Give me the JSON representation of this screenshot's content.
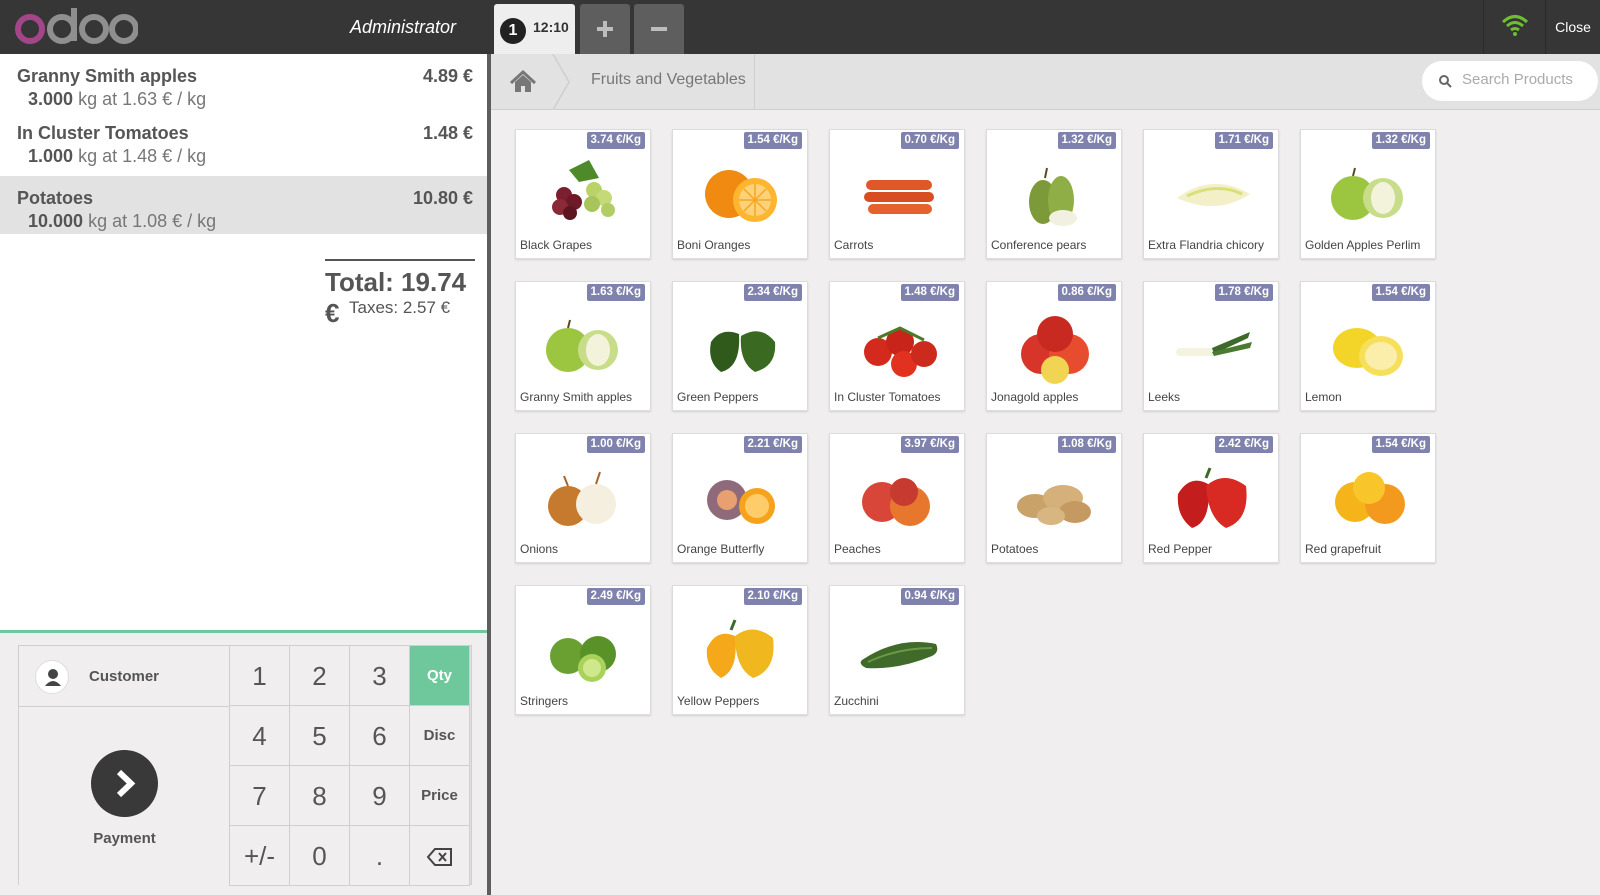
{
  "header": {
    "logo_text": "odoo",
    "user": "Administrator",
    "order": {
      "number": "1",
      "time": "12:10"
    },
    "close_label": "Close"
  },
  "order_lines": [
    {
      "name": "Granny Smith apples",
      "price": "4.89 €",
      "qty": "3.000",
      "detail": "kg at 1.63 € / kg",
      "selected": false
    },
    {
      "name": "In Cluster Tomatoes",
      "price": "1.48 €",
      "qty": "1.000",
      "detail": "kg at 1.48 € / kg",
      "selected": false
    },
    {
      "name": "Potatoes",
      "price": "10.80 €",
      "qty": "10.000",
      "detail": "kg at 1.08 € / kg",
      "selected": true
    }
  ],
  "summary": {
    "total": "Total: 19.74 €",
    "taxes": "Taxes: 2.57 €"
  },
  "pad": {
    "customer_label": "Customer",
    "payment_label": "Payment",
    "keys": [
      "1",
      "2",
      "3",
      "Qty",
      "4",
      "5",
      "6",
      "Disc",
      "7",
      "8",
      "9",
      "Price",
      "+/-",
      "0",
      ".",
      "⌫"
    ],
    "active_mode": "Qty"
  },
  "breadcrumb": {
    "category": "Fruits and Vegetables"
  },
  "search": {
    "placeholder": "Search Products"
  },
  "colors": {
    "accent": "#6ec89b",
    "price_tag": "#7f82ac",
    "topbar": "#363636"
  },
  "products": [
    {
      "name": "Black Grapes",
      "price": "3.74 €/Kg",
      "icon": "grapes"
    },
    {
      "name": "Boni Oranges",
      "price": "1.54 €/Kg",
      "icon": "orange"
    },
    {
      "name": "Carrots",
      "price": "0.70 €/Kg",
      "icon": "carrot"
    },
    {
      "name": "Conference pears",
      "price": "1.32 €/Kg",
      "icon": "pear"
    },
    {
      "name": "Extra Flandria chicory",
      "price": "1.71 €/Kg",
      "icon": "chicory"
    },
    {
      "name": "Golden Apples Perlim",
      "price": "1.32 €/Kg",
      "icon": "apple-green"
    },
    {
      "name": "Granny Smith apples",
      "price": "1.63 €/Kg",
      "icon": "apple-green"
    },
    {
      "name": "Green Peppers",
      "price": "2.34 €/Kg",
      "icon": "pepper-green"
    },
    {
      "name": "In Cluster Tomatoes",
      "price": "1.48 €/Kg",
      "icon": "tomato"
    },
    {
      "name": "Jonagold apples",
      "price": "0.86 €/Kg",
      "icon": "apple-red"
    },
    {
      "name": "Leeks",
      "price": "1.78 €/Kg",
      "icon": "leek"
    },
    {
      "name": "Lemon",
      "price": "1.54 €/Kg",
      "icon": "lemon"
    },
    {
      "name": "Onions",
      "price": "1.00 €/Kg",
      "icon": "onion"
    },
    {
      "name": "Orange Butterfly",
      "price": "2.21 €/Kg",
      "icon": "orange-butterfly"
    },
    {
      "name": "Peaches",
      "price": "3.97 €/Kg",
      "icon": "peach"
    },
    {
      "name": "Potatoes",
      "price": "1.08 €/Kg",
      "icon": "potato"
    },
    {
      "name": "Red Pepper",
      "price": "2.42 €/Kg",
      "icon": "pepper-red"
    },
    {
      "name": "Red grapefruit",
      "price": "1.54 €/Kg",
      "icon": "grapefruit"
    },
    {
      "name": "Stringers",
      "price": "2.49 €/Kg",
      "icon": "lime"
    },
    {
      "name": "Yellow Peppers",
      "price": "2.10 €/Kg",
      "icon": "pepper-yellow"
    },
    {
      "name": "Zucchini",
      "price": "0.94 €/Kg",
      "icon": "zucchini"
    }
  ]
}
